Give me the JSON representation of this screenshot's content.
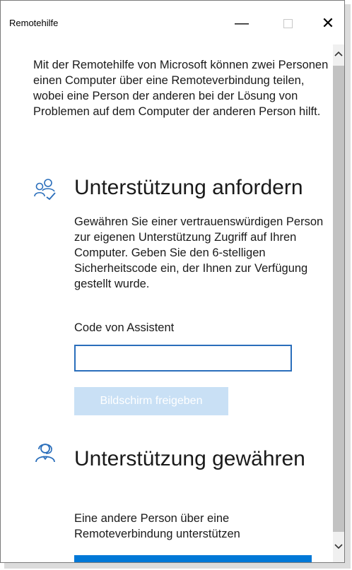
{
  "window": {
    "title": "Remotehilfe",
    "controls": {
      "minimize": "—",
      "close": "✕"
    }
  },
  "intro_text": "Mit der Remotehilfe von Microsoft können zwei Personen einen Computer über eine Remoteverbindung teilen, wobei eine Person der anderen bei der Lösung von Problemen auf dem Computer der anderen Person hilft.",
  "request_section": {
    "icon": "people-check-icon",
    "title": "Unterstützung anfordern",
    "description": "Gewähren Sie einer vertrauenswürdigen Person zur eigenen Unterstützung Zugriff auf Ihren Computer. Geben Sie den 6-stelligen Sicherheitscode ein, der Ihnen zur Verfügung gestellt wurde.",
    "code_label": "Code von Assistent",
    "code_value": "",
    "share_button": "Bildschirm freigeben",
    "share_button_state": "disabled"
  },
  "give_section": {
    "icon": "headset-person-icon",
    "title": "Unterstützung gewähren",
    "description": "Eine andere Person über eine Remoteverbindung unterstützen"
  },
  "colors": {
    "accent": "#0078d7",
    "input_border": "#2a6ebb",
    "disabled_button": "#c9e0f5",
    "icon": "#2a6ebb"
  }
}
